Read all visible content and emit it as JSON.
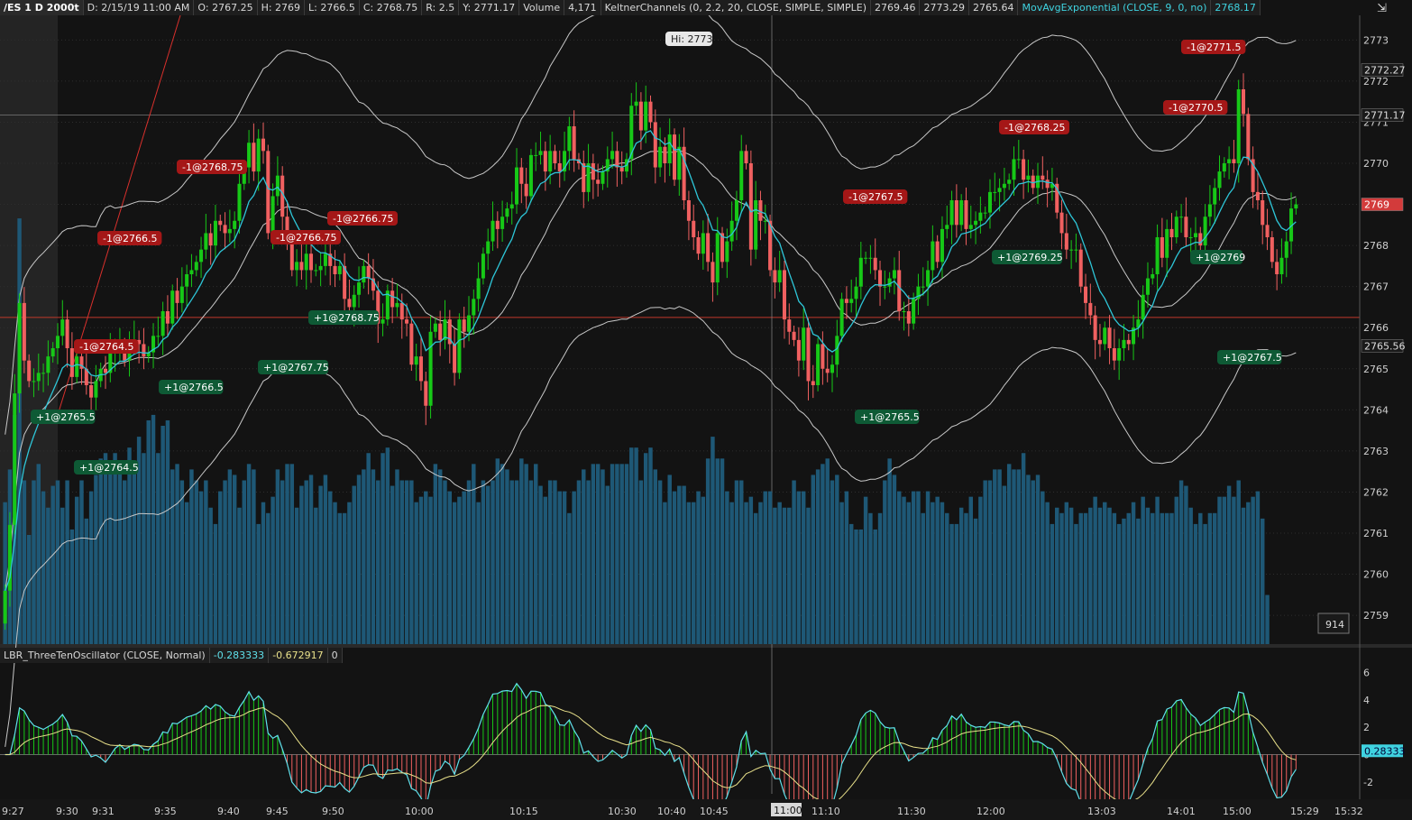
{
  "header": {
    "symbol": "/ES 1 D 2000t",
    "date": "D: 2/15/19 11:00 AM",
    "open": "O: 2767.25",
    "high": "H: 2769",
    "low": "L: 2766.5",
    "close": "C: 2768.75",
    "range": "R: 2.5",
    "y": "Y: 2771.17",
    "volume_label": "Volume",
    "volume_value": "4,171",
    "keltner_label": "KeltnerChannels (0, 2.2, 20, CLOSE, SIMPLE, SIMPLE)",
    "keltner_mid": "2769.46",
    "keltner_upper": "2773.29",
    "keltner_lower": "2765.64",
    "ema_label": "MovAvgExponential (CLOSE, 9, 0, no)",
    "ema_value": "2768.17",
    "corner_icon": "settings-arrows-icon"
  },
  "oscillator": {
    "label": "LBR_ThreeTenOscillator (CLOSE, Normal)",
    "value1": "-0.283333",
    "value2": "-0.672917",
    "value3": "0",
    "last_tag": "0.28333",
    "ticks": [
      "6",
      "4",
      "2",
      "0",
      "-2"
    ]
  },
  "colors": {
    "background": "#131313",
    "bull": "#17c817",
    "bear": "#f06060",
    "volume": "#1e5876",
    "keltner": "#c8c8c8",
    "ema": "#2ec6d8",
    "sell_badge": "#a51717",
    "buy_badge": "#0e5a35",
    "price_tag": "#d33b3b"
  },
  "chart_data": {
    "type": "candlestick",
    "symbol": "/ES",
    "y_ticks": [
      "2773",
      "2772",
      "2771",
      "2770",
      "2769",
      "2768",
      "2767",
      "2766",
      "2765",
      "2764",
      "2763",
      "2762",
      "2761",
      "2760",
      "2759"
    ],
    "y_range": [
      2758.3,
      2773.6
    ],
    "x_ticks": [
      "9:27",
      "9:30",
      "9:31",
      "9:35",
      "9:40",
      "9:45",
      "9:50",
      "10:00",
      "10:15",
      "10:30",
      "10:40",
      "10:45",
      "11:10",
      "11:30",
      "12:00",
      "13:03",
      "14:01",
      "15:00",
      "15:29",
      "15:32"
    ],
    "crosshair_time": "11:00",
    "price_tags": {
      "keltner_upper": "2772.27",
      "crosshair_price": "2771.17",
      "last_price": "2769",
      "keltner_lower": "2765.56"
    },
    "high_label": "Hi: 2773",
    "volume_scale_label": "914",
    "horizontal_line_price": 2766.25,
    "sell_fills": [
      "-1@2766.5",
      "-1@2768.75",
      "-1@2764.5",
      "-1@2766.75",
      "-1@2766.75",
      "-1@2767.5",
      "-1@2768.25",
      "-1@2770.5",
      "-1@2771.5"
    ],
    "buy_fills": [
      "+1@2765.5",
      "+1@2764.5",
      "+1@2766.5",
      "+1@2767.75",
      "+1@2768.75",
      "+1@2765.5",
      "+1@2769.25",
      "+1@2769",
      "+1@2767.5"
    ],
    "close_series": [
      2759.6,
      2761.2,
      2764.4,
      2766.6,
      2765.2,
      2764.7,
      2764.7,
      2764.9,
      2764.9,
      2765.3,
      2765.5,
      2765.8,
      2766.2,
      2765.5,
      2764.8,
      2765.3,
      2765.0,
      2764.6,
      2764.3,
      2764.7,
      2765.0,
      2764.9,
      2765.4,
      2765.5,
      2765.6,
      2765.2,
      2765.6,
      2765.7,
      2765.6,
      2765.3,
      2765.4,
      2765.8,
      2765.8,
      2766.4,
      2766.1,
      2766.9,
      2766.6,
      2767.0,
      2767.3,
      2767.4,
      2767.6,
      2767.9,
      2768.3,
      2768.0,
      2768.6,
      2768.5,
      2768.3,
      2768.4,
      2768.6,
      2769.5,
      2769.9,
      2770.5,
      2769.8,
      2770.6,
      2770.3,
      2768.3,
      2769.2,
      2769.7,
      2768.7,
      2768.2,
      2767.4,
      2767.6,
      2767.4,
      2767.8,
      2767.4,
      2767.4,
      2767.5,
      2767.8,
      2767.5,
      2767.3,
      2767.5,
      2766.7,
      2766.5,
      2766.8,
      2767.1,
      2767.5,
      2767.2,
      2766.9,
      2766.1,
      2766.2,
      2766.9,
      2766.5,
      2766.6,
      2766.2,
      2766.1,
      2765.1,
      2765.3,
      2764.7,
      2764.1,
      2765.9,
      2766.1,
      2765.7,
      2766.2,
      2765.6,
      2764.9,
      2766.2,
      2765.9,
      2766.3,
      2766.7,
      2767.2,
      2767.8,
      2768.1,
      2768.6,
      2768.4,
      2768.7,
      2768.9,
      2769.0,
      2769.9,
      2769.5,
      2769.2,
      2770.2,
      2770.2,
      2770.3,
      2769.8,
      2770.3,
      2770.0,
      2769.8,
      2770.3,
      2770.9,
      2770.1,
      2770.0,
      2769.3,
      2770.0,
      2769.6,
      2769.5,
      2769.8,
      2770.1,
      2770.3,
      2769.9,
      2769.8,
      2770.1,
      2771.4,
      2771.5,
      2770.8,
      2771.5,
      2771.0,
      2769.9,
      2770.4,
      2770.0,
      2770.7,
      2769.6,
      2770.4,
      2769.1,
      2768.6,
      2768.2,
      2767.8,
      2768.3,
      2767.6,
      2767.1,
      2768.3,
      2767.6,
      2768.1,
      2768.6,
      2769.1,
      2770.3,
      2770.0,
      2767.9,
      2769.1,
      2768.6,
      2768.6,
      2767.4,
      2767.1,
      2767.4,
      2766.2,
      2765.9,
      2765.7,
      2765.2,
      2766.0,
      2764.7,
      2764.6,
      2765.6,
      2765.0,
      2764.9,
      2765.1,
      2765.8,
      2766.7,
      2766.6,
      2766.7,
      2767.0,
      2767.7,
      2767.7,
      2767.7,
      2767.4,
      2767.0,
      2767.0,
      2767.2,
      2767.4,
      2766.4,
      2766.4,
      2766.1,
      2766.7,
      2767.0,
      2767.0,
      2767.4,
      2768.1,
      2767.6,
      2768.4,
      2768.5,
      2769.1,
      2768.5,
      2769.1,
      2768.4,
      2768.5,
      2768.6,
      2768.8,
      2768.8,
      2769.3,
      2769.3,
      2769.4,
      2769.5,
      2769.6,
      2770.1,
      2770.1,
      2769.6,
      2769.7,
      2769.4,
      2769.7,
      2769.6,
      2769.4,
      2769.5,
      2768.8,
      2768.3,
      2767.9,
      2767.9,
      2767.9,
      2767.0,
      2766.6,
      2766.3,
      2765.7,
      2765.6,
      2766.0,
      2765.5,
      2765.2,
      2765.5,
      2765.7,
      2765.6,
      2766.0,
      2766.2,
      2766.8,
      2767.2,
      2767.3,
      2768.2,
      2767.7,
      2768.4,
      2768.2,
      2768.7,
      2768.7,
      2768.2,
      2768.2,
      2768.3,
      2768.0,
      2768.7,
      2769.0,
      2769.4,
      2769.8,
      2770.0,
      2770.1,
      2770.0,
      2771.8,
      2771.2,
      2770.1,
      2769.3,
      2769.1,
      2768.5,
      2768.2,
      2767.6,
      2767.3,
      2767.7,
      2768.1,
      2768.9,
      2769.0
    ],
    "volume_series": [
      260,
      320,
      420,
      780,
      300,
      200,
      300,
      330,
      280,
      250,
      290,
      300,
      250,
      300,
      210,
      270,
      300,
      230,
      280,
      310,
      340,
      350,
      330,
      350,
      320,
      300,
      360,
      330,
      380,
      350,
      410,
      420,
      350,
      400,
      410,
      320,
      330,
      300,
      260,
      320,
      300,
      280,
      300,
      250,
      220,
      280,
      300,
      320,
      310,
      250,
      300,
      330,
      320,
      220,
      260,
      240,
      270,
      320,
      300,
      330,
      330,
      250,
      290,
      300,
      310,
      250,
      290,
      310,
      280,
      260,
      240,
      240,
      260,
      290,
      310,
      320,
      350,
      320,
      300,
      350,
      360,
      290,
      320,
      300,
      300,
      300,
      260,
      270,
      280,
      270,
      330,
      320,
      300,
      280,
      260,
      270,
      280,
      300,
      330,
      260,
      300,
      290,
      300,
      340,
      330,
      320,
      300,
      300,
      340,
      330,
      300,
      330,
      290,
      270,
      300,
      300,
      280,
      280,
      240,
      280,
      300,
      320,
      300,
      330,
      330,
      320,
      290,
      330,
      330,
      330,
      330,
      360,
      360,
      300,
      350,
      360,
      320,
      300,
      260,
      310,
      280,
      290,
      290,
      260,
      260,
      280,
      270,
      340,
      380,
      340,
      340,
      280,
      260,
      300,
      300,
      260,
      270,
      240,
      260,
      280,
      280,
      250,
      260,
      250,
      250,
      300,
      280,
      280,
      250,
      310,
      320,
      330,
      340,
      300,
      310,
      260,
      280,
      220,
      210,
      210,
      270,
      240,
      210,
      240,
      300,
      340,
      310,
      280,
      270,
      260,
      280,
      280,
      240,
      280,
      260,
      270,
      260,
      240,
      220,
      220,
      250,
      240,
      270,
      230,
      270,
      300,
      300,
      320,
      320,
      290,
      330,
      320,
      320,
      350,
      310,
      300,
      310,
      280,
      260,
      220,
      250,
      240,
      260,
      250,
      220,
      240,
      240,
      250,
      270,
      250,
      260,
      250,
      240,
      220,
      230,
      240,
      260,
      230,
      270,
      250,
      240,
      270,
      240,
      240,
      240,
      270,
      300,
      290,
      250,
      220,
      240,
      220,
      240,
      240,
      270,
      270,
      290,
      270,
      300,
      250,
      260,
      270,
      280,
      230,
      90
    ]
  }
}
